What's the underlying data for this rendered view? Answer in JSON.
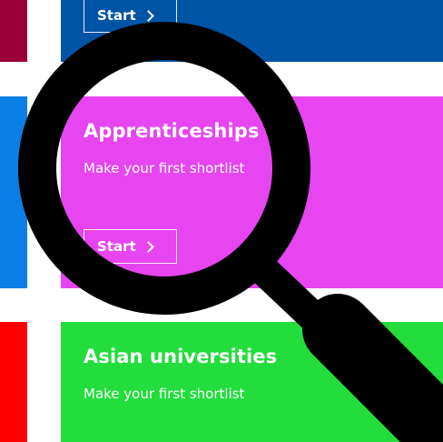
{
  "colors": {
    "top_card": "#0054a6",
    "top_strip": "#9b0038",
    "apprenticeships_card": "#e645f0",
    "middle_strip": "#0a7fe6",
    "asian_card": "#22dd3c",
    "bottom_strip": "#ff0000",
    "magnifier": "#000000"
  },
  "cards": {
    "top": {
      "start_label": "Start"
    },
    "apprenticeships": {
      "title": "Apprenticeships",
      "subtitle": "Make your first shortlist",
      "start_label": "Start"
    },
    "asian": {
      "title": "Asian universities",
      "subtitle": "Make your first shortlist"
    }
  },
  "icons": {
    "chevron": "chevron-right-icon",
    "overlay": "magnifying-glass-icon"
  }
}
